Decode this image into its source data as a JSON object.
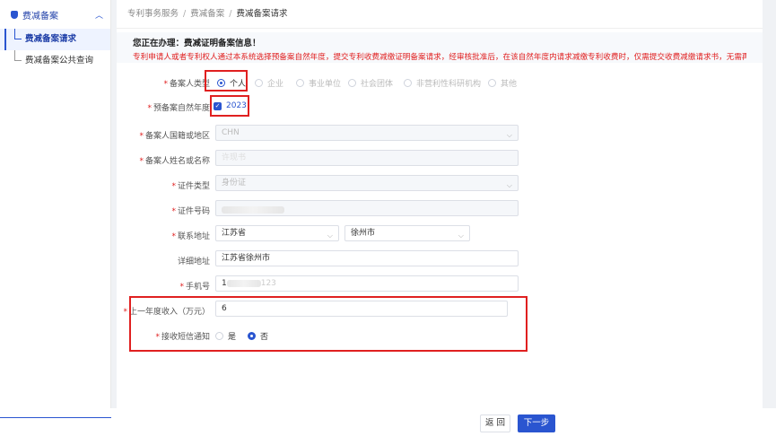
{
  "sidebar": {
    "title": "费减备案",
    "items": [
      {
        "label": "费减备案请求"
      },
      {
        "label": "费减备案公共查询"
      }
    ]
  },
  "breadcrumb": [
    "专利事务服务",
    "费减备案",
    "费减备案请求"
  ],
  "notice": {
    "title": "您正在办理：费减证明备案信息！",
    "text": "专利申请人或者专利权人通过本系统选择预备案自然年度，提交专利收费减缴证明备案请求，经审核批准后，在该自然年度内请求减缴专利收费时，仅需提交收费减缴请求书，无需再提交相关证明材料。"
  },
  "form": {
    "applicant_type": {
      "label": "备案人类型",
      "options": [
        "个人",
        "企业",
        "事业单位",
        "社会团体",
        "非营利性科研机构",
        "其他"
      ],
      "selected": "个人"
    },
    "year": {
      "label": "预备案自然年度",
      "value": "2023"
    },
    "region": {
      "label": "备案人国籍或地区",
      "value": "CHN"
    },
    "name": {
      "label": "备案人姓名或名称",
      "value": "许现书"
    },
    "id_type": {
      "label": "证件类型",
      "value": "身份证"
    },
    "id_number": {
      "label": "证件号码"
    },
    "address": {
      "label": "联系地址",
      "province": "江苏省",
      "city": "徐州市"
    },
    "detail_address": {
      "label": "详细地址",
      "value": "江苏省徐州市"
    },
    "phone": {
      "label": "手机号",
      "prefix": "1",
      "suffix": "123"
    },
    "income": {
      "label": "上一年度收入（万元）",
      "value": "6"
    },
    "sms": {
      "label": "接收短信通知",
      "options": [
        "是",
        "否"
      ],
      "selected": "否"
    }
  },
  "buttons": {
    "back": "返 回",
    "next": "下一步"
  }
}
